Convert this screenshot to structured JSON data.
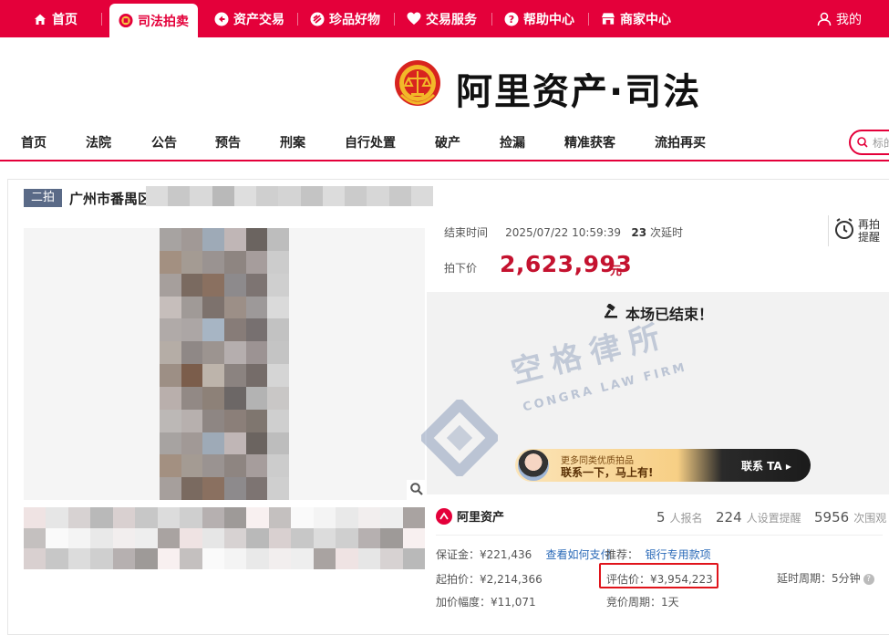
{
  "top_nav": {
    "items": [
      {
        "label": "首页",
        "icon": "home-icon"
      },
      {
        "label": "司法拍卖",
        "icon": "court-emblem-icon",
        "active": true
      },
      {
        "label": "资产交易",
        "icon": "asset-exchange-icon"
      },
      {
        "label": "珍品好物",
        "icon": "treasure-icon"
      },
      {
        "label": "交易服务",
        "icon": "heart-service-icon"
      },
      {
        "label": "帮助中心",
        "icon": "help-icon"
      },
      {
        "label": "商家中心",
        "icon": "merchant-icon"
      }
    ],
    "account": {
      "label": "我的",
      "icon": "user-icon"
    },
    "accent_color": "#e4003a"
  },
  "brand": {
    "text": "阿里资产·司法",
    "emblem": "court-emblem"
  },
  "sub_nav": {
    "items": [
      "首页",
      "法院",
      "公告",
      "预告",
      "刑案",
      "自行处置",
      "破产",
      "捡漏",
      "精准获客",
      "流拍再买"
    ],
    "search_placeholder": "标的"
  },
  "listing": {
    "round_badge": "二拍",
    "title_visible": "广州市番禺区",
    "end_time_label": "结束时间",
    "end_time": "2025/07/22 10:59:39",
    "delay_count": "23",
    "delay_suffix": "次延时",
    "remind_label_1": "再拍",
    "remind_label_2": "提醒",
    "final_price_label": "拍下价",
    "final_price": "2,623,993",
    "price_unit": "元",
    "ended_text": "本场已结束！"
  },
  "watermark": {
    "cn": "空格律所",
    "en": "CONGRA LAW FIRM"
  },
  "ad_banner": {
    "line1": "更多同类优质拍品",
    "line2": "联系一下，马上有!",
    "cta": "联系 TA ▸"
  },
  "stats": {
    "platform": "阿里资产",
    "signups": "5",
    "signups_label": "人报名",
    "reminders": "224",
    "reminders_label": "人设置提醒",
    "watchers": "5956",
    "watchers_label": "次围观"
  },
  "details": {
    "deposit": "保证金：¥221,436",
    "deposit_link": "查看如何支付",
    "recommend_label": "推荐：",
    "recommend_link": "银行专用款项",
    "start_price": "起拍价：¥2,214,366",
    "appraisal": "评估价：¥3,954,223",
    "delay_period": "延时周期：5分钟",
    "increment": "加价幅度：¥11,071",
    "bid_period": "竞价周期：1天"
  }
}
